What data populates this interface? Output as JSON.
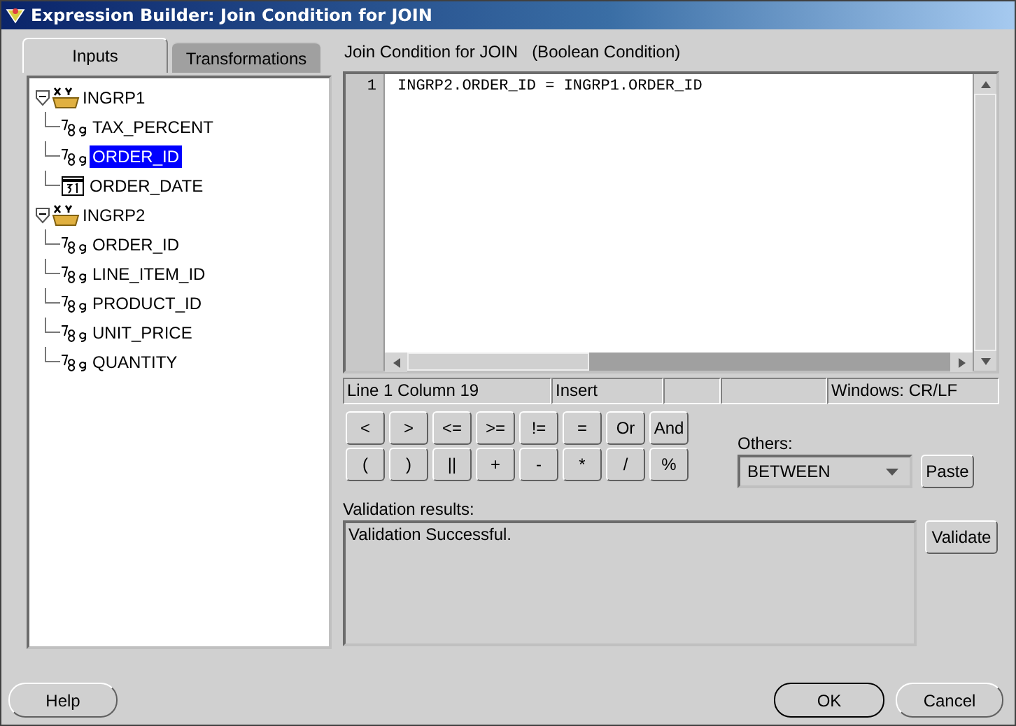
{
  "window": {
    "title": "Expression Builder: Join Condition for JOIN"
  },
  "tabs": [
    {
      "label": "Inputs",
      "selected": true
    },
    {
      "label": "Transformations",
      "selected": false
    }
  ],
  "tree": [
    {
      "label": "INGRP1",
      "expanded": true,
      "selected": false,
      "children": [
        {
          "label": "TAX_PERCENT",
          "kind": "number",
          "selected": false
        },
        {
          "label": "ORDER_ID",
          "kind": "number",
          "selected": true
        },
        {
          "label": "ORDER_DATE",
          "kind": "date",
          "selected": false
        }
      ]
    },
    {
      "label": "INGRP2",
      "expanded": true,
      "selected": false,
      "children": [
        {
          "label": "ORDER_ID",
          "kind": "number",
          "selected": false
        },
        {
          "label": "LINE_ITEM_ID",
          "kind": "number",
          "selected": false
        },
        {
          "label": "PRODUCT_ID",
          "kind": "number",
          "selected": false
        },
        {
          "label": "UNIT_PRICE",
          "kind": "number",
          "selected": false
        },
        {
          "label": "QUANTITY",
          "kind": "number",
          "selected": false
        }
      ]
    }
  ],
  "editor": {
    "heading": "Join Condition for JOIN",
    "subheading": "(Boolean Condition)",
    "lines": [
      {
        "number": "1",
        "text": "INGRP2.ORDER_ID = INGRP1.ORDER_ID"
      }
    ]
  },
  "status_bar": {
    "position": "Line 1 Column 19",
    "mode": "Insert",
    "line_ending": "Windows: CR/LF"
  },
  "operators": [
    [
      "<",
      ">",
      "<=",
      ">=",
      "!=",
      "=",
      "Or",
      "And"
    ],
    [
      "(",
      ")",
      "||",
      "+",
      "-",
      "*",
      "/",
      "%"
    ]
  ],
  "others": {
    "label": "Others:",
    "value": "BETWEEN",
    "paste": "Paste"
  },
  "validation": {
    "label": "Validation results:",
    "result": "Validation Successful.",
    "button": "Validate"
  },
  "buttons": {
    "help": "Help",
    "ok": "OK",
    "cancel": "Cancel"
  }
}
